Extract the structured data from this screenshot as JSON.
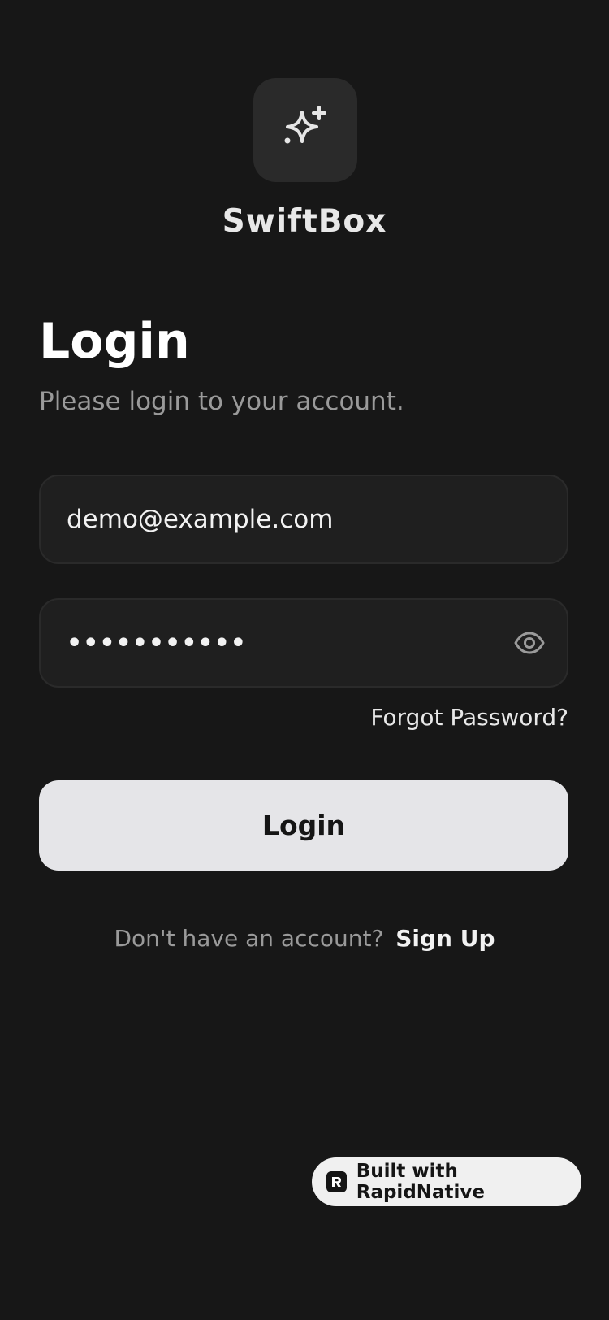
{
  "app": {
    "name": "SwiftBox",
    "logo_icon": "sparkles-icon"
  },
  "login": {
    "title": "Login",
    "subtitle": "Please login to your account.",
    "email_value": "demo@example.com",
    "password_value": "•••••••••••",
    "password_toggle_icon": "eye-icon",
    "forgot_label": "Forgot Password?",
    "button_label": "Login",
    "signup_prompt": "Don't have an account?",
    "signup_label": "Sign Up"
  },
  "badge": {
    "label": "Built with RapidNative",
    "icon": "rapidnative-logo-icon"
  },
  "colors": {
    "background": "#171717",
    "field_background": "#1f1f1f",
    "button_background": "#e5e5e8",
    "muted_text": "#9a9a9a"
  }
}
